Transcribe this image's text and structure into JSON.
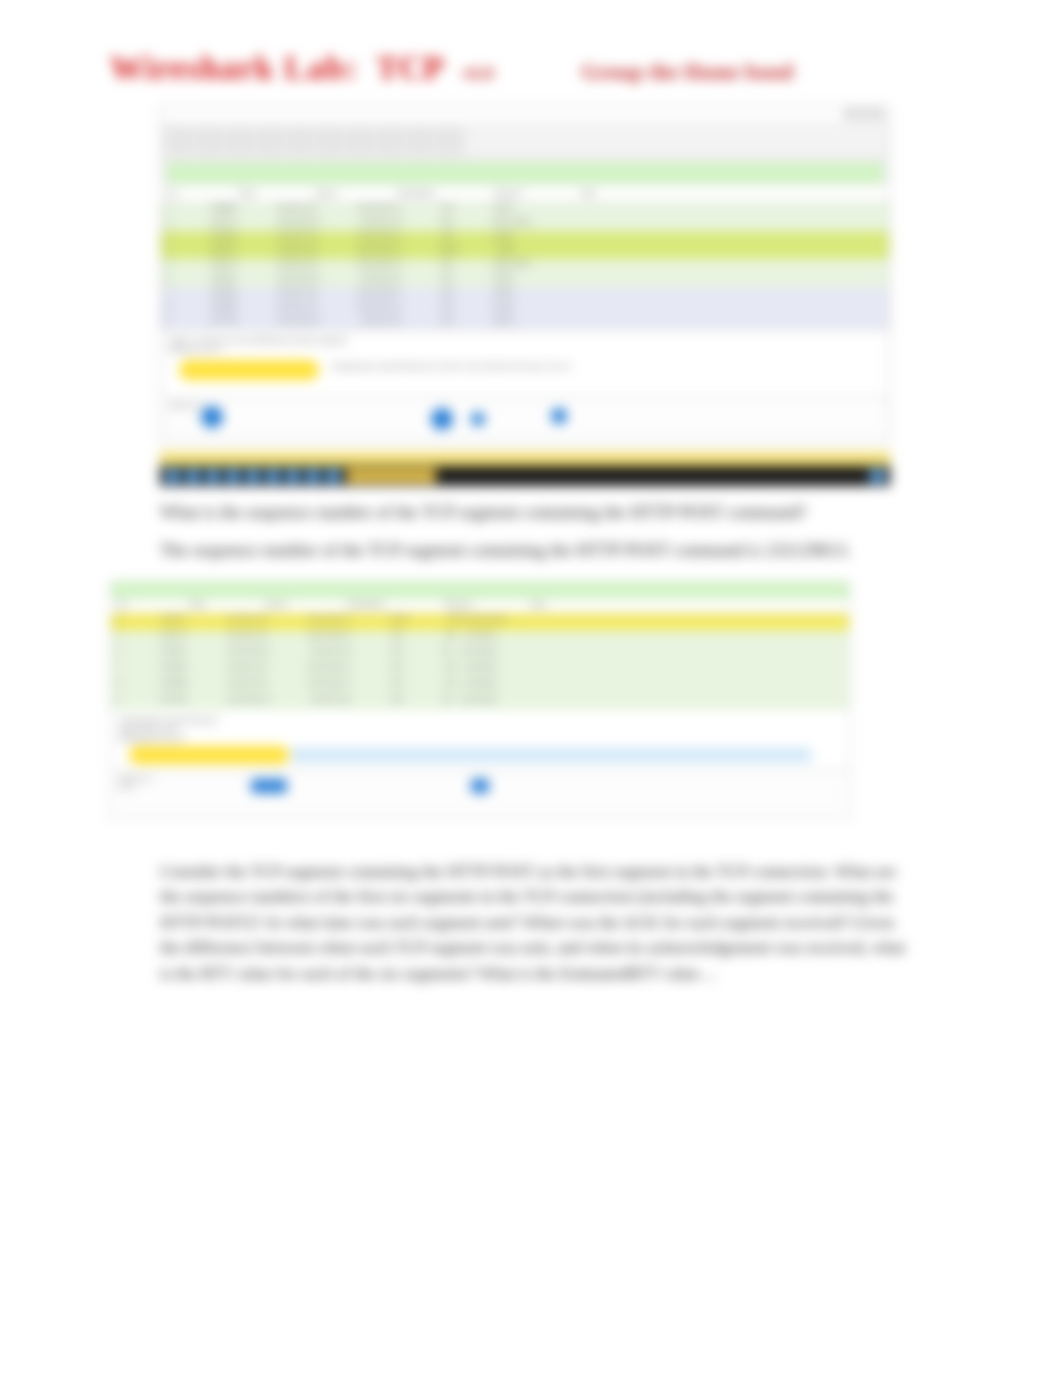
{
  "header": {
    "title_part1": "Wireshark Lab:",
    "title_part2": "TCP",
    "version": "v6.0",
    "author": "Group the Home bond"
  },
  "wireshark1": {
    "menu": [
      "File",
      "Edit",
      "View",
      "Go",
      "Capture",
      "Analyze",
      "Statistics",
      "Telephony",
      "Wireless",
      "Tools",
      "Help"
    ],
    "filter": "tcp",
    "columns": [
      "No.",
      "Time",
      "Source",
      "Destination",
      "Protocol",
      "Length",
      "Info"
    ],
    "rows": [
      {
        "no": "1",
        "time": "0.000000",
        "src": "192.168.1.102",
        "dst": "128.119.245.12",
        "proto": "TCP",
        "len": "62",
        "info": "[SYN]"
      },
      {
        "no": "2",
        "time": "0.023172",
        "src": "128.119.245.12",
        "dst": "192.168.1.102",
        "proto": "TCP",
        "len": "62",
        "info": "[SYN, ACK]"
      },
      {
        "no": "3",
        "time": "0.023265",
        "src": "192.168.1.102",
        "dst": "128.119.245.12",
        "proto": "TCP",
        "len": "54",
        "info": "[ACK]"
      },
      {
        "no": "4",
        "time": "0.026477",
        "src": "192.168.1.102",
        "dst": "128.119.245.12",
        "proto": "HTTP",
        "len": "619",
        "info": "POST"
      },
      {
        "no": "5",
        "time": "0.041737",
        "src": "192.168.1.102",
        "dst": "128.119.245.12",
        "proto": "TCP",
        "len": "1514",
        "info": "[PSH, ACK]"
      },
      {
        "no": "6",
        "time": "0.053937",
        "src": "128.119.245.12",
        "dst": "192.168.1.102",
        "proto": "TCP",
        "len": "60",
        "info": "[ACK]"
      },
      {
        "no": "7",
        "time": "0.054026",
        "src": "192.168.1.102",
        "dst": "128.119.245.12",
        "proto": "TCP",
        "len": "1514",
        "info": "[ACK]"
      },
      {
        "no": "8",
        "time": "0.054690",
        "src": "192.168.1.102",
        "dst": "128.119.245.12",
        "proto": "TCP",
        "len": "1514",
        "info": "[ACK]"
      },
      {
        "no": "9",
        "time": "0.077294",
        "src": "128.119.245.12",
        "dst": "192.168.1.102",
        "proto": "TCP",
        "len": "60",
        "info": "[ACK]"
      }
    ],
    "detail_lines": [
      "Frame 1: 62 bytes on wire (496 bits), 62 bytes captured",
      "Ethernet II, Src: ...",
      "Internet Protocol Version 4, Src: 192.168.1.102, Dst: 128.119.245.12",
      "Transmission Control Protocol, Src Port: 1161, Dst Port: 80, Seq: 0, Len: 0"
    ],
    "highlight_detail": "Sequence number: 0"
  },
  "question4": "What is the sequence number of the TCP segment containing the HTTP POST command?",
  "answer4": "The sequence number of the TCP segment containing the HTTP POST command is 232129013.",
  "wireshark2": {
    "filter": "tcp",
    "columns": [
      "No.",
      "Time",
      "Source",
      "Destination",
      "Protocol",
      "Length",
      "Info"
    ],
    "rows": [
      {
        "no": "4",
        "time": "0.026477",
        "src": "192.168.1.102",
        "dst": "128.119.245.12",
        "proto": "HTTP",
        "len": "619",
        "info": "POST /ethereal-labs/..."
      },
      {
        "no": "5",
        "time": "0.041737",
        "src": "192.168.1.102",
        "dst": "128.119.245.12",
        "proto": "TCP",
        "len": "1514",
        "info": "1161 → 80 [ACK]"
      },
      {
        "no": "6",
        "time": "0.053937",
        "src": "128.119.245.12",
        "dst": "192.168.1.102",
        "proto": "TCP",
        "len": "60",
        "info": "80 → 1161 [ACK]"
      },
      {
        "no": "7",
        "time": "0.054026",
        "src": "192.168.1.102",
        "dst": "128.119.245.12",
        "proto": "TCP",
        "len": "1514",
        "info": "1161 → 80 [ACK]"
      },
      {
        "no": "8",
        "time": "0.054690",
        "src": "192.168.1.102",
        "dst": "128.119.245.12",
        "proto": "TCP",
        "len": "1514",
        "info": "1161 → 80 [ACK]"
      },
      {
        "no": "9",
        "time": "0.077294",
        "src": "128.119.245.12",
        "dst": "192.168.1.102",
        "proto": "TCP",
        "len": "60",
        "info": "80 → 1161 [ACK]"
      }
    ],
    "highlight_detail": "Sequence number: 232129013",
    "detail_lines": [
      "Transmission Control Protocol",
      "Source Port: 1161",
      "Destination Port: 80",
      "[Stream index: 0]",
      "Sequence number: 232129013    (relative sequence number)",
      "Acknowledgment number: ..."
    ]
  },
  "question5": "Consider the TCP segment containing the HTTP POST as the first segment in the TCP connection. What are the sequence numbers of the first six segments in the TCP connection (including the segment containing the HTTP POST)? At what time was each segment sent? When was the ACK for each segment received? Given the difference between when each TCP segment was sent, and when its acknowledgement was received, what is the RTT value for each of the six segments? What is the EstimatedRTT value ..."
}
